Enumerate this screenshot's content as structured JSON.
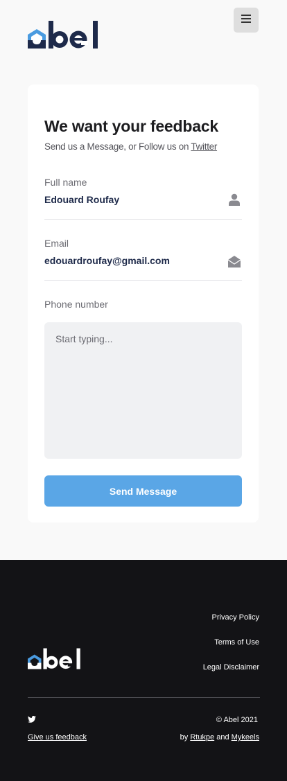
{
  "brand": {
    "name": "abel",
    "accent": "#4a9be0",
    "dark": "#1e2a4a"
  },
  "header": {
    "menu_icon": "hamburger-icon"
  },
  "form": {
    "title": "We want your feedback",
    "subtitle": "Send us a Message, or Follow us on",
    "subtitle_link": "Twitter",
    "full_name": {
      "label": "Full name",
      "value": "Edouard Roufay",
      "icon": "user-icon"
    },
    "email": {
      "label": "Email",
      "value": "edouardroufay@gmail.com",
      "icon": "envelope-open-icon"
    },
    "phone": {
      "label": "Phone number",
      "placeholder": "Start typing..."
    },
    "submit_label": "Send Message",
    "submit_color": "#5aa6e6"
  },
  "footer": {
    "links": [
      "Privacy Policy",
      "Terms of Use",
      "Legal Disclaimer"
    ],
    "social_icon": "twitter-icon",
    "feedback_link": "Give us feedback",
    "copyright": "© Abel 2021",
    "credits_prefix": "by",
    "credit_1": "Rtukpe",
    "credits_and": "and",
    "credit_2": "Mykeels"
  }
}
